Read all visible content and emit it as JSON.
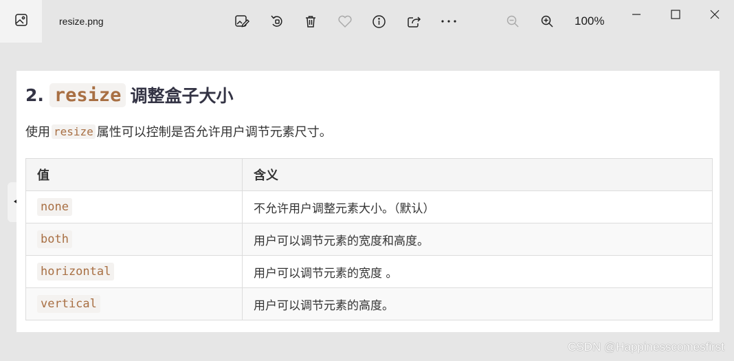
{
  "titlebar": {
    "filename": "resize.png",
    "zoom": "100%",
    "icons": {
      "app": "photo-icon",
      "edit": "edit-image-icon",
      "rotate": "rotate-icon",
      "delete": "trash-icon",
      "favorite": "heart-icon",
      "info": "info-icon",
      "share": "share-icon",
      "more": "more-icon",
      "zoom_out": "zoom-out-icon",
      "zoom_in": "zoom-in-icon",
      "minimize": "minimize-icon",
      "maximize": "maximize-icon",
      "close": "close-icon"
    }
  },
  "doc": {
    "heading_num": "2.",
    "heading_code": "resize",
    "heading_text": "调整盒子大小",
    "para_before": "使用",
    "para_code": "resize",
    "para_after": "属性可以控制是否允许用户调节元素尺寸。",
    "table": {
      "headers": [
        "值",
        "含义"
      ],
      "rows": [
        {
          "value": "none",
          "meaning": "不允许用户调整元素大小。（默认）"
        },
        {
          "value": "both",
          "meaning": "用户可以调节元素的宽度和高度。"
        },
        {
          "value": "horizontal",
          "meaning": "用户可以调节元素的宽度 。"
        },
        {
          "value": "vertical",
          "meaning": "用户可以调节元素的高度。"
        }
      ]
    }
  },
  "watermark": "CSDN @Happinesscomesfirst",
  "colors": {
    "code_text": "#a86f43",
    "code_bg": "#f4f2f0",
    "window_bg": "#e6e6e6"
  }
}
